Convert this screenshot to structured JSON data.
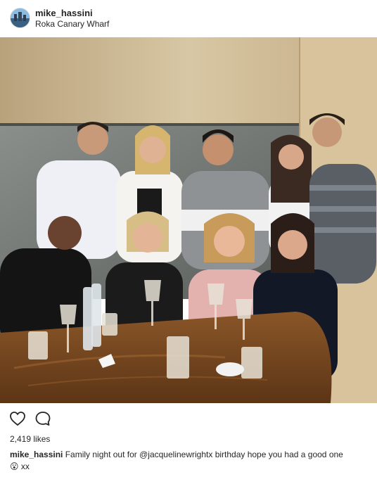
{
  "post": {
    "username": "mike_hassini",
    "location": "Roka Canary Wharf",
    "likes": "2,419 likes",
    "caption": {
      "username": "mike_hassini",
      "text_before": "Family night out for",
      "mention": "@jacquelinewrightx",
      "text_after": "birthday hope you had a good one",
      "emoji": "😮",
      "suffix": "xx"
    }
  },
  "icons": {
    "like": "heart-icon",
    "comment": "comment-icon"
  },
  "colors": {
    "text": "#262626",
    "table": "#7a4a22",
    "wall": "#cdb792"
  }
}
